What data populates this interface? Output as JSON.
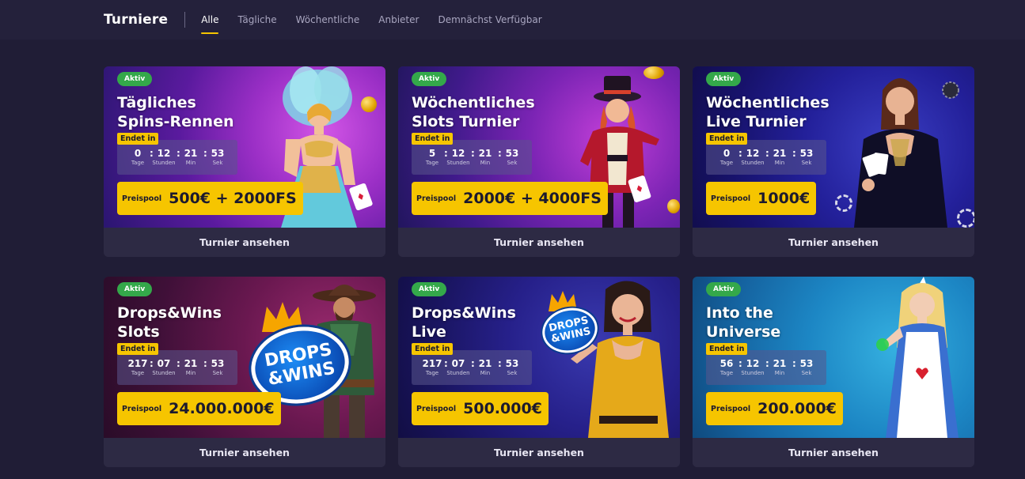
{
  "nav": {
    "title": "Turniere",
    "tabs": [
      {
        "label": "Alle",
        "active": true
      },
      {
        "label": "Tägliche",
        "active": false
      },
      {
        "label": "Wöchentliche",
        "active": false
      },
      {
        "label": "Anbieter",
        "active": false
      },
      {
        "label": "Demnächst Verfügbar",
        "active": false
      }
    ]
  },
  "labels": {
    "ends_in": "Endet in",
    "days": "Tage",
    "hours": "Stunden",
    "minutes": "Min",
    "seconds": "Sek",
    "prize_pool": "Preispool",
    "view_button": "Turnier ansehen"
  },
  "colors": {
    "accent": "#f6c500",
    "active_badge": "#34a84a",
    "page_bg": "#201d36",
    "card_footer": "#2d2a44"
  },
  "cards": [
    {
      "status": "Aktiv",
      "title_line1": "Tägliches",
      "title_line2": "Spins-Rennen",
      "days": "0",
      "hours": "12",
      "minutes": "21",
      "seconds": "53",
      "prize": "500€ + 2000FS",
      "button": "Turnier ansehen",
      "art": "showgirl-illustration"
    },
    {
      "status": "Aktiv",
      "title_line1": "Wöchentliches",
      "title_line2": "Slots Turnier",
      "days": "5",
      "hours": "12",
      "minutes": "21",
      "seconds": "53",
      "prize": "2000€ + 4000FS",
      "button": "Turnier ansehen",
      "art": "ringmaster-illustration"
    },
    {
      "status": "Aktiv",
      "title_line1": "Wöchentliches",
      "title_line2": "Live Turnier",
      "days": "0",
      "hours": "12",
      "minutes": "21",
      "seconds": "53",
      "prize": "1000€",
      "button": "Turnier ansehen",
      "art": "live-dealer-photo"
    },
    {
      "status": "Aktiv",
      "title_line1": "Drops&Wins",
      "title_line2": "Slots",
      "days": "217",
      "hours": "07",
      "minutes": "21",
      "seconds": "53",
      "prize": "24.000.000€",
      "button": "Turnier ansehen",
      "art": "cowboy-illustration",
      "logo_top": "DROPS",
      "logo_bottom": "&WINS"
    },
    {
      "status": "Aktiv",
      "title_line1": "Drops&Wins",
      "title_line2": "Live",
      "days": "217",
      "hours": "07",
      "minutes": "21",
      "seconds": "53",
      "prize": "500.000€",
      "button": "Turnier ansehen",
      "art": "woman-yellow-dress-photo",
      "logo_top": "DROPS",
      "logo_bottom": "&WINS"
    },
    {
      "status": "Aktiv",
      "title_line1": "Into the",
      "title_line2": "Universe",
      "days": "56",
      "hours": "12",
      "minutes": "21",
      "seconds": "53",
      "prize": "200.000€",
      "button": "Turnier ansehen",
      "art": "alice-illustration"
    }
  ]
}
